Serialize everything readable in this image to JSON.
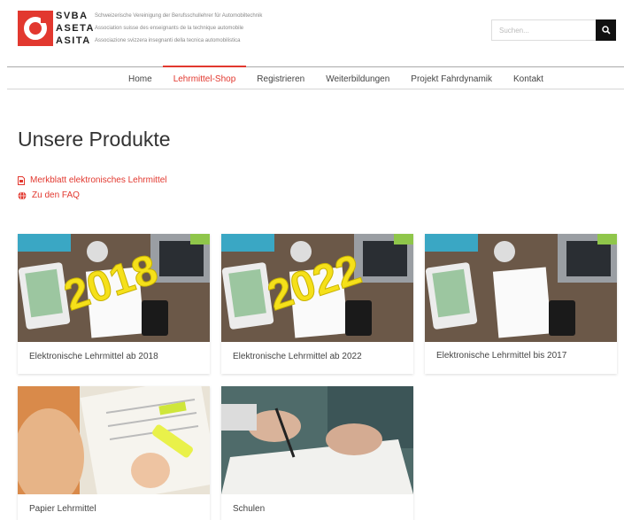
{
  "brand": {
    "rows": [
      {
        "code": "SVBA",
        "desc": "Schweizerische Vereinigung der Berufsschullehrer für Automobiltechnik"
      },
      {
        "code": "ASETA",
        "desc": "Association suisse des enseignants de la technique automobile"
      },
      {
        "code": "ASITA",
        "desc": "Associazione svizzera insegnanti della tecnica automobilistica"
      }
    ],
    "accent": "#e2382f"
  },
  "search": {
    "placeholder": "Suchen..."
  },
  "nav": {
    "items": [
      {
        "label": "Home"
      },
      {
        "label": "Lehrmittel-Shop",
        "active": true
      },
      {
        "label": "Registrieren"
      },
      {
        "label": "Weiterbildungen"
      },
      {
        "label": "Projekt Fahrdynamik"
      },
      {
        "label": "Kontakt"
      }
    ]
  },
  "main": {
    "title": "Unsere Produkte",
    "links": [
      {
        "label": "Merkblatt elektronisches Lehrmittel",
        "icon": "pdf-icon"
      },
      {
        "label": "Zu den FAQ",
        "icon": "globe-icon"
      }
    ]
  },
  "products": [
    {
      "label": "Elektronische Lehrmittel ab 2018",
      "overlay": "2018"
    },
    {
      "label": "Elektronische Lehrmittel ab 2022",
      "overlay": "2022"
    },
    {
      "label": "Elektronische Lehrmittel bis 2017",
      "overlay": ""
    },
    {
      "label": "Papier Lehrmittel",
      "overlay": ""
    },
    {
      "label": "Schulen",
      "overlay": ""
    }
  ]
}
